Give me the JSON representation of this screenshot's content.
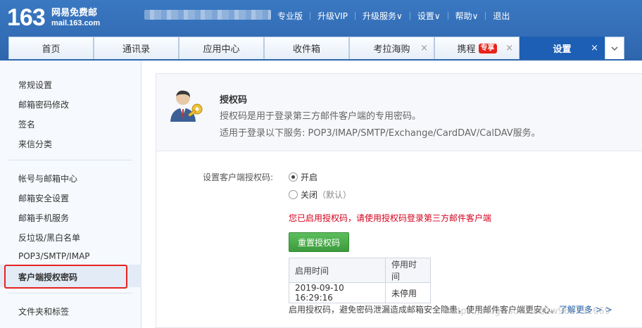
{
  "header": {
    "logo_number": "163",
    "logo_text": "网易免费邮",
    "logo_domain": "mail.163.com",
    "nav": [
      {
        "label": "专业版"
      },
      {
        "label": "升级VIP"
      },
      {
        "label": "升级服务∨"
      },
      {
        "label": "设置∨"
      },
      {
        "label": "帮助∨"
      },
      {
        "label": "退出"
      }
    ]
  },
  "tabs": [
    {
      "label": "首页"
    },
    {
      "label": "通讯录"
    },
    {
      "label": "应用中心"
    },
    {
      "label": "收件箱"
    },
    {
      "label": "考拉海购",
      "close": "×"
    },
    {
      "label": "携程",
      "badge": "专享",
      "close": "×"
    },
    {
      "label": "设置",
      "close": "×",
      "active": true
    }
  ],
  "tab_more_icon": "chevron-down-icon",
  "sidebar": {
    "items": [
      {
        "label": "常规设置"
      },
      {
        "label": "邮箱密码修改"
      },
      {
        "label": "签名"
      },
      {
        "label": "来信分类"
      },
      {
        "label": "帐号与邮箱中心"
      },
      {
        "label": "邮箱安全设置"
      },
      {
        "label": "邮箱手机服务"
      },
      {
        "label": "反垃圾/黑白名单"
      },
      {
        "label": "POP3/SMTP/IMAP"
      },
      {
        "label": "客户端授权密码"
      },
      {
        "label": "文件夹和标签"
      }
    ]
  },
  "main": {
    "icon": "user-key-icon",
    "title": "授权码",
    "desc1": "授权码是用于登录第三方邮件客户端的专用密码。",
    "desc2": "适用于登录以下服务: POP3/IMAP/SMTP/Exchange/CardDAV/CalDAV服务。",
    "setting_label": "设置客户端授权码:",
    "option_on": "开启",
    "option_off": "关闭",
    "option_off_note": "（默认）",
    "selected": "开启",
    "notice": "您已启用授权码，请使用授权码登录第三方邮件客户端",
    "reset_button": "重置授权码",
    "table": {
      "headers": [
        "启用时间",
        "停用时间"
      ],
      "rows": [
        [
          "2019-09-10 16:29:16",
          "未停用"
        ]
      ]
    },
    "footer_note": "启用授权码，避免密码泄漏造成邮箱安全隐患，使用邮件客户端更安心。",
    "learn_more": "了解更多 > >"
  },
  "watermark": "https://blog.csdn.net/zw961791669",
  "colors": {
    "header_bg": "#2e66ad",
    "active_tab": "#1c5fb4",
    "notice_red": "#d6001c",
    "button_green": "#3c9b3c",
    "highlight_red": "#e52222"
  }
}
